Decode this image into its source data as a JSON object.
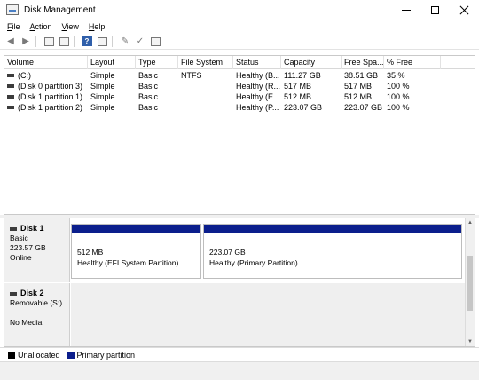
{
  "window": {
    "title": "Disk Management"
  },
  "menu": [
    {
      "pre": "",
      "key": "F",
      "rest": "ile"
    },
    {
      "pre": "",
      "key": "A",
      "rest": "ction"
    },
    {
      "pre": "",
      "key": "V",
      "rest": "iew"
    },
    {
      "pre": "",
      "key": "H",
      "rest": "elp"
    }
  ],
  "columns": [
    "Volume",
    "Layout",
    "Type",
    "File System",
    "Status",
    "Capacity",
    "Free Spa...",
    "% Free"
  ],
  "volumes": [
    [
      "(C:)",
      "Simple",
      "Basic",
      "NTFS",
      "Healthy (B...",
      "111.27 GB",
      "38.51 GB",
      "35 %"
    ],
    [
      "(Disk 0 partition 3)",
      "Simple",
      "Basic",
      "",
      "Healthy (R...",
      "517 MB",
      "517 MB",
      "100 %"
    ],
    [
      "(Disk 1 partition 1)",
      "Simple",
      "Basic",
      "",
      "Healthy (E...",
      "512 MB",
      "512 MB",
      "100 %"
    ],
    [
      "(Disk 1 partition 2)",
      "Simple",
      "Basic",
      "",
      "Healthy (P...",
      "223.07 GB",
      "223.07 GB",
      "100 %"
    ]
  ],
  "disks": [
    {
      "name": "Disk 1",
      "type": "Basic",
      "size": "223.57 GB",
      "state": "Online",
      "partitions": [
        {
          "size": "512 MB",
          "status": "Healthy (EFI System Partition)"
        },
        {
          "size": "223.07 GB",
          "status": "Healthy (Primary Partition)"
        }
      ]
    },
    {
      "name": "Disk 2",
      "type": "Removable (S:)",
      "size": "",
      "state": "No Media"
    }
  ],
  "legend": [
    {
      "label": "Unallocated",
      "color": "#000000"
    },
    {
      "label": "Primary partition",
      "color": "#0b1e8c"
    }
  ],
  "icons": [
    "back-arrow-icon",
    "forward-arrow-icon",
    "console-tree-icon",
    "properties-icon",
    "help-icon",
    "disk-list-icon",
    "rescan-icon",
    "settings-icon"
  ]
}
